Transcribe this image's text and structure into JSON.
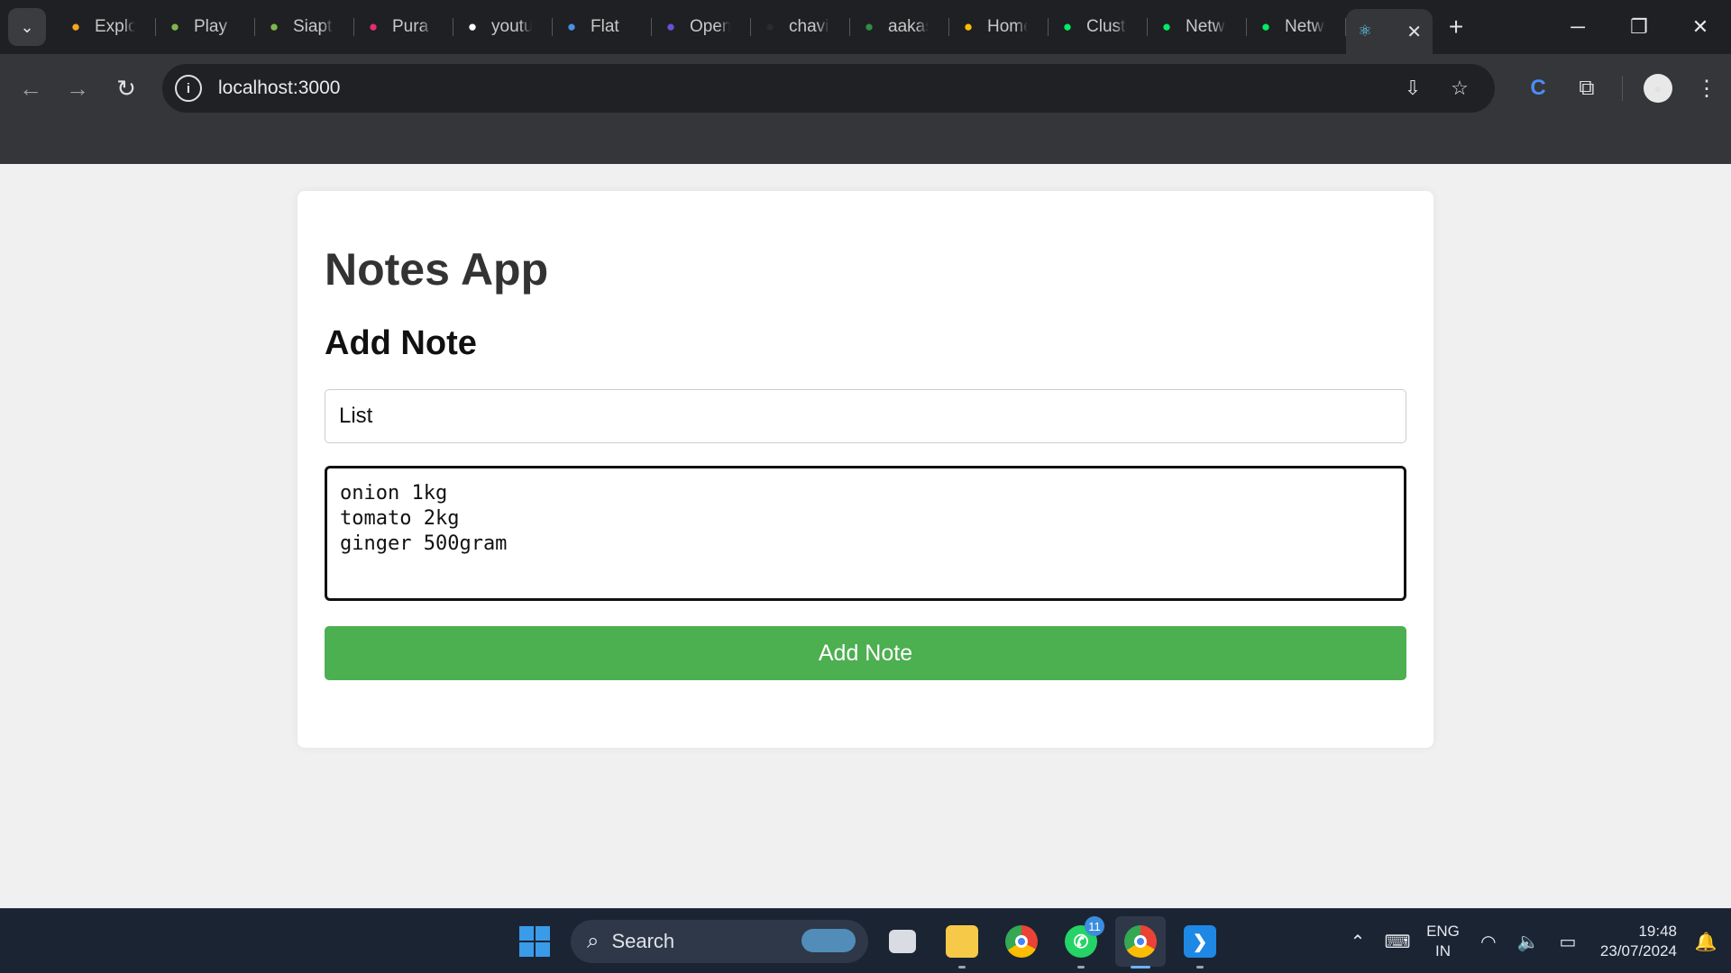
{
  "browser": {
    "tabs": [
      {
        "title": "Explore",
        "icon": "lightning-icon",
        "color": "#f5a623"
      },
      {
        "title": "Play",
        "icon": "chess-pawn-icon",
        "color": "#81b64c"
      },
      {
        "title": "Siapt",
        "icon": "chess-pawn-icon",
        "color": "#81b64c"
      },
      {
        "title": "Pura",
        "icon": "instagram-icon",
        "color": "#e1306c"
      },
      {
        "title": "youtube",
        "icon": "google-icon",
        "color": "#ffffff"
      },
      {
        "title": "Flat",
        "icon": "flat-icon",
        "color": "#4a90e2"
      },
      {
        "title": "Open",
        "icon": "list-icon",
        "color": "#6b4fd8"
      },
      {
        "title": "chavi",
        "icon": "github-icon",
        "color": "#2b2b2b"
      },
      {
        "title": "aakas",
        "icon": "gfg-icon",
        "color": "#2f8d46"
      },
      {
        "title": "Home",
        "icon": "drive-icon",
        "color": "#fbbc04"
      },
      {
        "title": "Cluster",
        "icon": "mongodb-leaf-icon",
        "color": "#00ed64"
      },
      {
        "title": "Network",
        "icon": "mongodb-leaf-icon",
        "color": "#00ed64"
      },
      {
        "title": "Network",
        "icon": "mongodb-leaf-icon",
        "color": "#00ed64"
      }
    ],
    "active_tab": {
      "title": "",
      "icon": "react-icon",
      "close": "✕"
    },
    "new_tab": "+",
    "address": "localhost:3000"
  },
  "app": {
    "title": "Notes App",
    "subtitle": "Add Note",
    "title_input_value": "List",
    "note_value": "onion 1kg\ntomato 2kg\nginger 500gram",
    "submit_label": "Add Note",
    "accent_color": "#4caf50"
  },
  "taskbar": {
    "search_label": "Search",
    "whatsapp_badge": "11",
    "language": [
      "ENG",
      "IN"
    ],
    "time": "19:48",
    "date": "23/07/2024"
  }
}
